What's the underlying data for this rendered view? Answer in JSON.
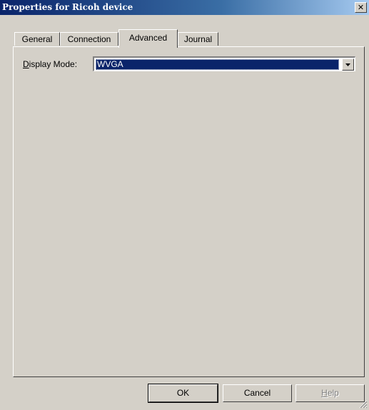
{
  "window": {
    "title": "Properties for Ricoh device",
    "close_glyph": "✕"
  },
  "tabs": [
    {
      "label": "General"
    },
    {
      "label": "Connection"
    },
    {
      "label": "Advanced",
      "active": true
    },
    {
      "label": "Journal"
    }
  ],
  "advanced": {
    "display_mode_label": "Display Mode:",
    "display_mode_mnemonic": "D",
    "display_mode_rest": "isplay Mode:",
    "display_mode_value": "WVGA"
  },
  "buttons": {
    "ok": "OK",
    "cancel": "Cancel",
    "help": "Help",
    "help_mnemonic": "H",
    "help_rest": "elp"
  },
  "colors": {
    "titlebar": "#0a246a",
    "selection": "#0a246a",
    "face": "#d4d0c8"
  }
}
